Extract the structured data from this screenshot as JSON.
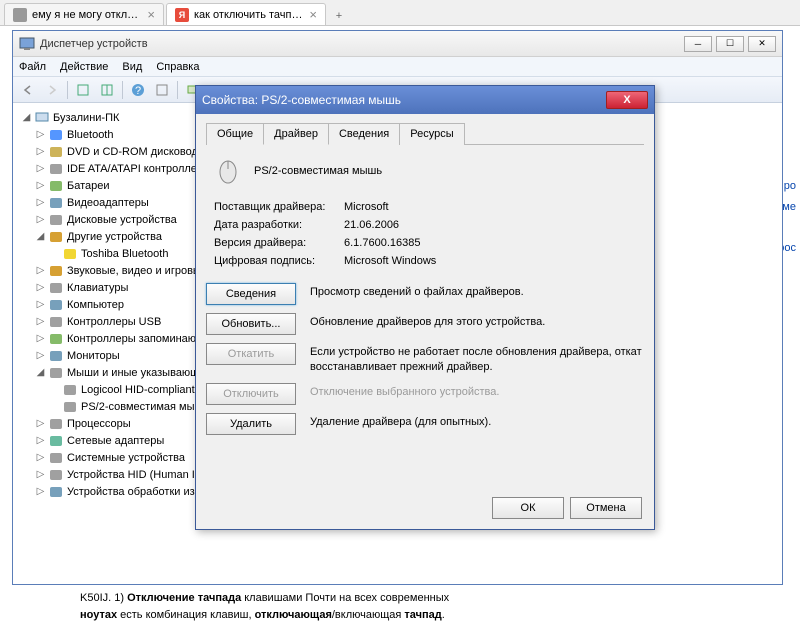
{
  "browser": {
    "tabs": [
      {
        "title": "ему я не могу отключит...",
        "favicon": "gray"
      },
      {
        "title": "как отключить тачпад на н...",
        "favicon": "Я"
      }
    ]
  },
  "device_manager": {
    "title": "Диспетчер устройств",
    "menu": {
      "file": "Файл",
      "action": "Действие",
      "view": "Вид",
      "help": "Справка"
    },
    "root": "Бузалини-ПК",
    "nodes": [
      {
        "label": "Bluetooth",
        "icon": "bt"
      },
      {
        "label": "DVD и CD-ROM дисководы",
        "icon": "disc"
      },
      {
        "label": "IDE ATA/ATAPI контроллеры",
        "icon": "ide"
      },
      {
        "label": "Батареи",
        "icon": "bat"
      },
      {
        "label": "Видеоадаптеры",
        "icon": "disp"
      },
      {
        "label": "Дисковые устройства",
        "icon": "hdd"
      },
      {
        "label": "Другие устройства",
        "icon": "other",
        "expanded": true,
        "children": [
          {
            "label": "Toshiba Bluetooth",
            "icon": "warn"
          }
        ]
      },
      {
        "label": "Звуковые, видео и игровые устройства",
        "icon": "snd"
      },
      {
        "label": "Клавиатуры",
        "icon": "kbd"
      },
      {
        "label": "Компьютер",
        "icon": "pc"
      },
      {
        "label": "Контроллеры USB",
        "icon": "usb"
      },
      {
        "label": "Контроллеры запоминающих устройств",
        "icon": "stor"
      },
      {
        "label": "Мониторы",
        "icon": "mon"
      },
      {
        "label": "Мыши и иные указывающие устройства",
        "icon": "mouse",
        "expanded": true,
        "children": [
          {
            "label": "Logicool HID-compliant",
            "icon": "mouse"
          },
          {
            "label": "PS/2-совместимая мышь",
            "icon": "mouse"
          }
        ]
      },
      {
        "label": "Процессоры",
        "icon": "cpu"
      },
      {
        "label": "Сетевые адаптеры",
        "icon": "net"
      },
      {
        "label": "Системные устройства",
        "icon": "sys"
      },
      {
        "label": "Устройства HID (Human Interface Devices)",
        "icon": "hid"
      },
      {
        "label": "Устройства обработки изображений",
        "icon": "img"
      }
    ]
  },
  "dialog": {
    "title": "Свойства: PS/2-совместимая мышь",
    "tabs": {
      "general": "Общие",
      "driver": "Драйвер",
      "details": "Сведения",
      "resources": "Ресурсы"
    },
    "device_name": "PS/2-совместимая мышь",
    "info": {
      "provider_label": "Поставщик драйвера:",
      "provider": "Microsoft",
      "date_label": "Дата разработки:",
      "date": "21.06.2006",
      "version_label": "Версия драйвера:",
      "version": "6.1.7600.16385",
      "signer_label": "Цифровая подпись:",
      "signer": "Microsoft Windows"
    },
    "actions": {
      "details": {
        "btn": "Сведения",
        "desc": "Просмотр сведений о файлах драйверов."
      },
      "update": {
        "btn": "Обновить...",
        "desc": "Обновление драйверов для этого устройства."
      },
      "rollback": {
        "btn": "Откатить",
        "desc": "Если устройство не работает после обновления драйвера, откат восстанавливает прежний драйвер."
      },
      "disable": {
        "btn": "Отключить",
        "desc": "Отключение выбранного устройства."
      },
      "delete": {
        "btn": "Удалить",
        "desc": "Удаление драйвера (для опытных)."
      }
    },
    "ok": "ОК",
    "cancel": "Отмена"
  },
  "side_links": {
    "a": "о запро",
    "b": "ов в ме",
    "c": "запрос"
  },
  "page_text_parts": {
    "p1": "K50IJ. 1) ",
    "p2": "Отключение тачпада",
    "p3": " клавишами Почти на всех современных ",
    "p4": "ноутах",
    "p5": " есть комбинация клавиш, ",
    "p6": "отключающая",
    "p7": "/включающая ",
    "p8": "тачпад",
    "p9": "."
  }
}
